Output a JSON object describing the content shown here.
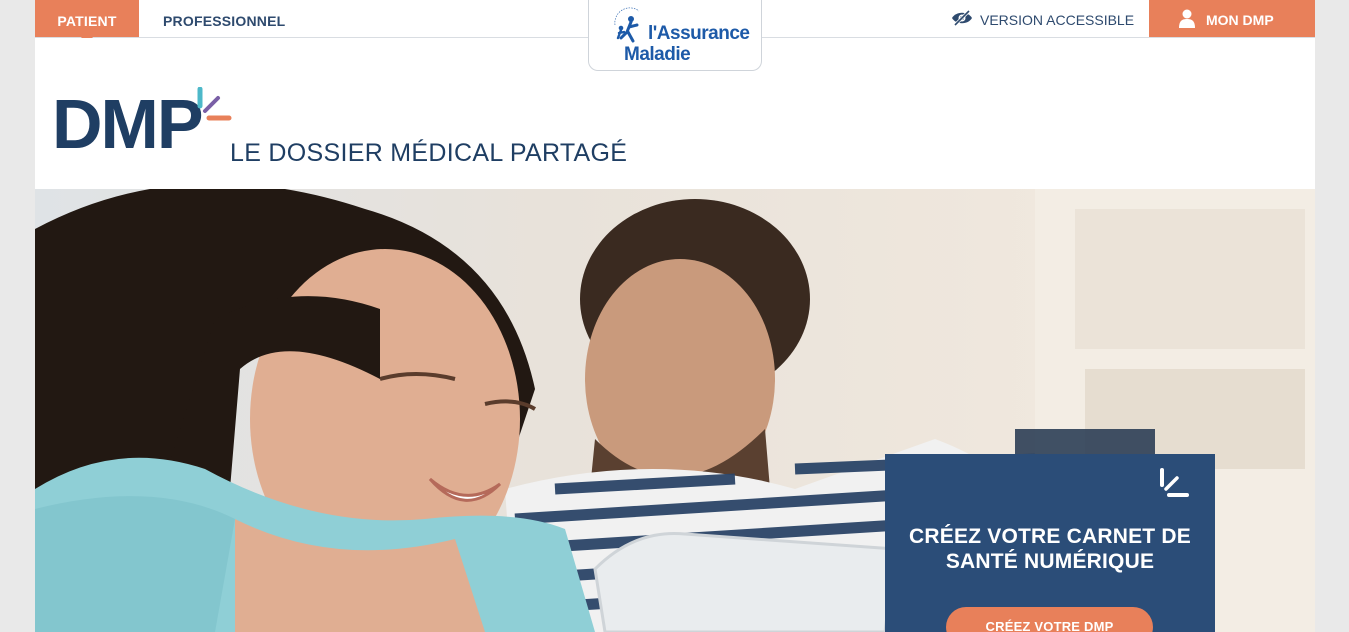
{
  "colors": {
    "accent": "#e8805a",
    "navy": "#1f3e63",
    "cta_bg": "#2b4d78",
    "brand_blue": "#1d5aa8"
  },
  "topnav": {
    "tabs": [
      {
        "label": "PATIENT",
        "active": true
      },
      {
        "label": "PROFESSIONNEL",
        "active": false
      }
    ],
    "logo": {
      "line1": "l'Assurance",
      "line2": "Maladie",
      "ring_text": "SÉCURITÉ SOCIALE"
    },
    "accessible": {
      "label": "VERSION ACCESSIBLE",
      "icon": "eye-slash-icon"
    },
    "account": {
      "label": "MON DMP",
      "icon": "user-icon"
    }
  },
  "brand": {
    "logo_text": "DMP",
    "subtitle": "LE DOSSIER MÉDICAL PARTAGÉ"
  },
  "hero": {
    "cta": {
      "title_line1": "CRÉEZ VOTRE CARNET DE",
      "title_line2": "SANTÉ NUMÉRIQUE",
      "button_label": "CRÉEZ VOTRE DMP",
      "icon": "dmp-spark-icon"
    }
  }
}
